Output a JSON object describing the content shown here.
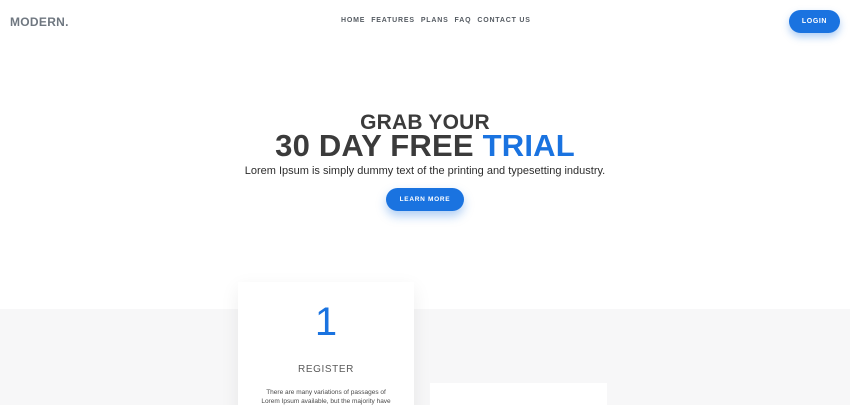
{
  "header": {
    "logo": "MODERN.",
    "nav": [
      "HOME",
      "FEATURES",
      "PLANS",
      "FAQ",
      "CONTACT US"
    ],
    "login_label": "LOGIN"
  },
  "hero": {
    "eyebrow": "GRAB YOUR",
    "title_main": "30 DAY FREE",
    "title_accent": "TRIAL",
    "subtitle": "Lorem Ipsum is simply dummy text of the printing and typesetting industry.",
    "cta_label": "LEARN MORE"
  },
  "steps": [
    {
      "number": "1",
      "title": "REGISTER",
      "text": "There are many variations of passages of Lorem Ipsum available, but the majority have"
    }
  ],
  "colors": {
    "accent": "#1a73e0",
    "heading": "#3b3b3b",
    "band": "#f7f7f8"
  }
}
